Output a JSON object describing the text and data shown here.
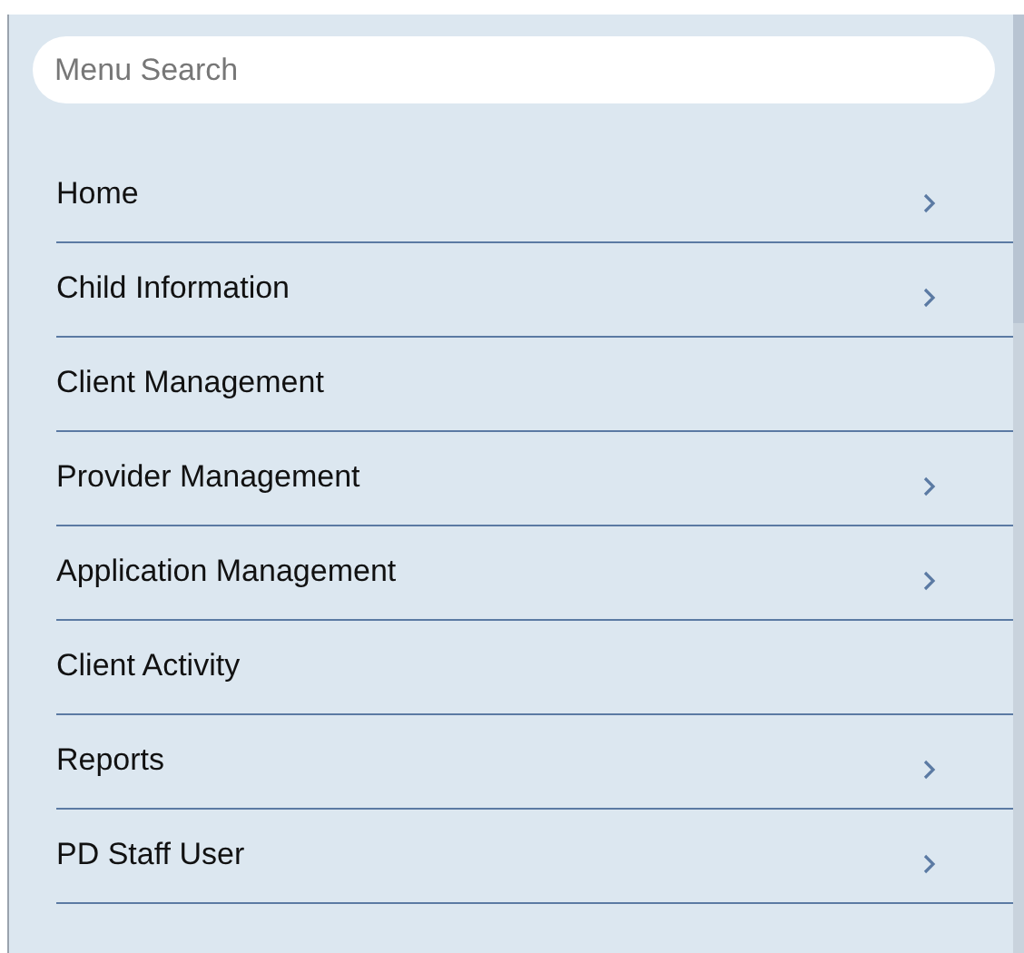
{
  "search": {
    "placeholder": "Menu Search"
  },
  "menu": {
    "items": [
      {
        "label": "Home",
        "has_submenu": true
      },
      {
        "label": "Child Information",
        "has_submenu": true
      },
      {
        "label": "Client Management",
        "has_submenu": false
      },
      {
        "label": "Provider Management",
        "has_submenu": true
      },
      {
        "label": "Application Management",
        "has_submenu": true
      },
      {
        "label": "Client Activity",
        "has_submenu": false
      },
      {
        "label": "Reports",
        "has_submenu": true
      },
      {
        "label": "PD Staff User",
        "has_submenu": true
      }
    ]
  }
}
